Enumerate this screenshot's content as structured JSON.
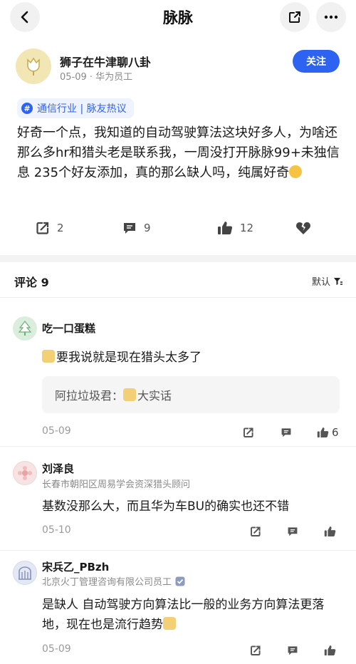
{
  "header": {
    "title": "脉脉",
    "back_icon": "chevron-left-icon",
    "share_icon": "share-icon",
    "more_icon": "more-icon"
  },
  "post": {
    "author": "狮子在牛津聊八卦",
    "meta": "05-09 · 华为员工",
    "follow_label": "关注",
    "topic": "通信行业 | 脉友热议",
    "body": "好奇一个点，我知道的自动驾驶算法这块好多人，为啥还那么多hr和猎头老是联系我，一周没打开脉脉99+未独信息 235个好友添加，真的那么缺人吗，纯属好奇",
    "repost_count": "2",
    "comment_count": "9",
    "like_count": "12"
  },
  "comments_header": {
    "title": "评论 9",
    "sort_label": "默认"
  },
  "comments": [
    {
      "name": "吃一口蛋糕",
      "subtitle": "",
      "text": "要我说就是现在猎头太多了",
      "reply": {
        "author": "阿拉垃圾君：",
        "text": "大实话"
      },
      "date": "05-09",
      "likes": "6"
    },
    {
      "name": "刘泽良",
      "subtitle": "长春市朝阳区周易学会资深猎头顾问",
      "text": "基数没那么大，而且华为车BU的确实也还不错",
      "date": "05-10",
      "likes": ""
    },
    {
      "name": "宋兵乙_PBzh",
      "subtitle": "北京火丁管理咨询有限公司员工",
      "text": "是缺人  自动驾驶方向算法比一般的业务方向算法更落地，现在也是流行趋势",
      "date": "05-09",
      "likes": ""
    }
  ],
  "colors": {
    "accent": "#2d63f0",
    "tag_bg": "#eef3ff",
    "separator": "#f3f3f4"
  }
}
